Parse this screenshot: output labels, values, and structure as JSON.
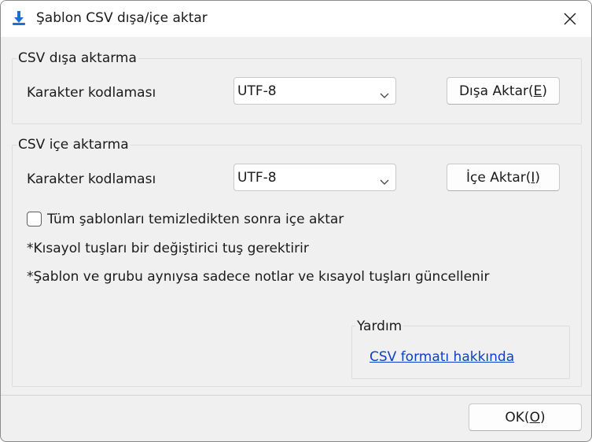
{
  "window": {
    "title": "Şablon CSV dışa/içe aktar",
    "icon": "download-arrow-icon",
    "close_icon": "close-icon"
  },
  "export_group": {
    "title": "CSV dışa aktarma",
    "encoding_label": "Karakter kodlaması",
    "encoding_value": "UTF-8",
    "button_text": "Dışa Aktar(",
    "button_accel": "E",
    "button_close": ")"
  },
  "import_group": {
    "title": "CSV içe aktarma",
    "encoding_label": "Karakter kodlaması",
    "encoding_value": "UTF-8",
    "button_text": "İçe Aktar(",
    "button_accel": "I",
    "button_close": ")",
    "checkbox_label": "Tüm şablonları temizledikten sonra içe aktar",
    "checkbox_checked": false,
    "note1": "*Kısayol tuşları bir değiştirici tuş gerektirir",
    "note2": "*Şablon ve grubu aynıysa sadece notlar ve kısayol tuşları güncellenir"
  },
  "help_group": {
    "title": "Yardım",
    "link_text": "CSV formatı hakkında"
  },
  "footer": {
    "ok_text": "OK(",
    "ok_accel": "O",
    "ok_close": ")"
  },
  "colors": {
    "accent_icon": "#1a6fd1",
    "link": "#0a3fc9",
    "window_bg": "#f0f0f0"
  }
}
